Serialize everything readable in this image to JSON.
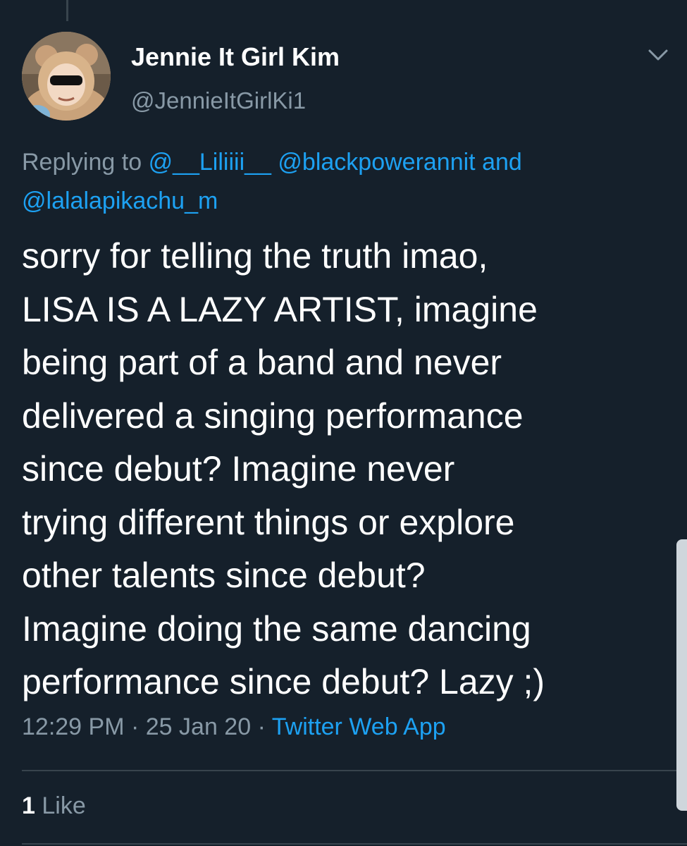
{
  "author": {
    "name": "Jennie It Girl Kim",
    "handle": "@JennieItGirlKi1"
  },
  "reply": {
    "prefix": "Replying to",
    "mentions": [
      "@__Liliiii__",
      "@blackpowerannit",
      "@lalalapikachu_m"
    ],
    "joiner": "and"
  },
  "tweet": {
    "lines": [
      "sorry for telling the truth imao,",
      "LISA IS A LAZY ARTIST, imagine",
      "being part of a band and never",
      "delivered a singing performance",
      "since debut? Imagine never",
      "trying different things or explore",
      "other talents since debut?",
      "Imagine doing the same dancing",
      "performance since debut? Lazy ;)"
    ]
  },
  "meta": {
    "time": "12:29 PM",
    "date": "25 Jan 20",
    "separator": "·",
    "source": "Twitter Web App"
  },
  "stats": {
    "like_count": "1",
    "like_label": "Like"
  },
  "icons": {
    "menu": "chevron-down-icon",
    "avatar": "avatar"
  },
  "colors": {
    "background": "#15202b",
    "text": "#ffffff",
    "secondary": "#8899a6",
    "link": "#1da1f2",
    "divider": "#38444d"
  }
}
